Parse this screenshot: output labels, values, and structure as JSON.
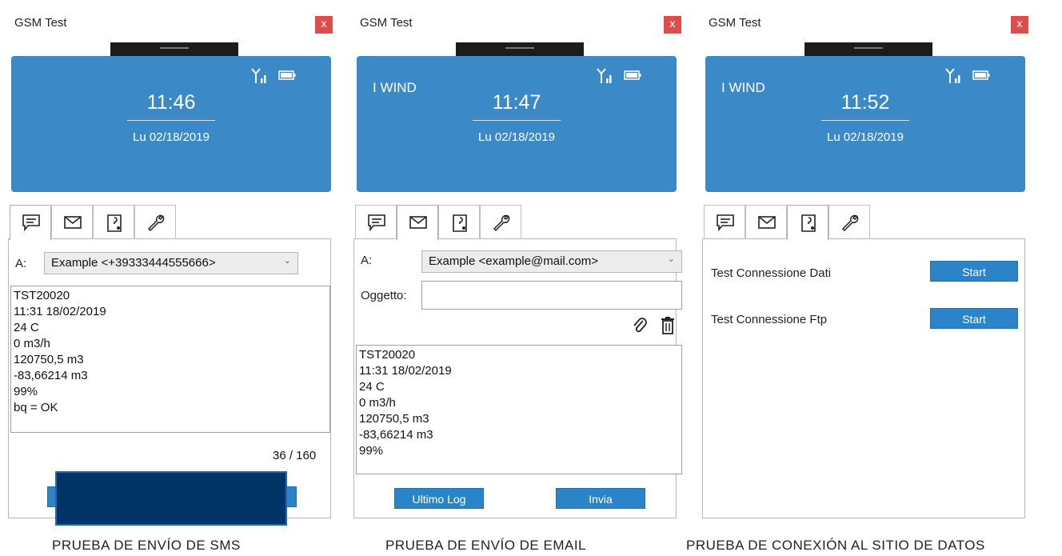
{
  "window_title": "GSM Test",
  "close_label": "x",
  "date": "Lu 02/18/2019",
  "sms_panel": {
    "time": "11:46",
    "to_label": "A:",
    "recipient": "Example <+39333444555666>",
    "message_lines": [
      "TST20020",
      "11:31 18/02/2019",
      "24 C",
      "0 m3/h",
      "120750,5 m3",
      "-83,66214 m3",
      "99%",
      "bq = OK"
    ],
    "char_counter": "36 / 160",
    "caption": "PRUEBA DE ENVÍO DE SMS"
  },
  "email_panel": {
    "operator": "I WIND",
    "time": "11:47",
    "to_label": "A:",
    "recipient": "Example <example@mail.com>",
    "subject_label": "Oggetto:",
    "subject_value": "",
    "message_lines": [
      "TST20020",
      "11:31 18/02/2019",
      "24 C",
      "0 m3/h",
      "120750,5 m3",
      "-83,66214 m3",
      "99%"
    ],
    "last_log_button": "Ultimo Log",
    "send_button": "Invia",
    "caption": "PRUEBA DE ENVÍO DE EMAIL"
  },
  "data_panel": {
    "operator": "I WIND",
    "time": "11:52",
    "test_data_label": "Test Connessione Dati",
    "test_data_button": "Start",
    "test_ftp_label": "Test Connessione Ftp",
    "test_ftp_button": "Start",
    "caption": "PRUEBA DE CONEXIÓN AL SITIO DE DATOS"
  },
  "icons": {
    "tab_sms": "message-icon",
    "tab_email": "envelope-icon",
    "tab_data": "document-connection-icon",
    "tab_tools": "wrench-icon",
    "status_signal": "signal-icon",
    "status_battery": "battery-icon",
    "attach": "paperclip-icon",
    "delete": "trash-icon"
  },
  "colors": {
    "screen_blue": "#3b8ac7",
    "button_blue": "#2c84c8",
    "close_red": "#e04b4b",
    "redaction": "#003366"
  }
}
